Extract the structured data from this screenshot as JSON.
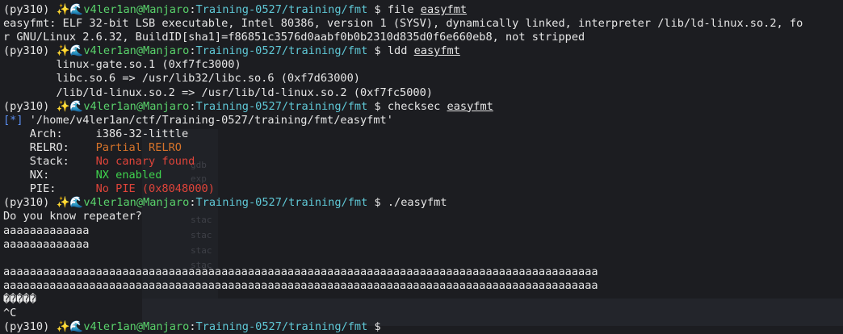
{
  "env": "(py310)",
  "user_host": "v4ler1an@Manjaro",
  "cwd_prefix": ":",
  "cwd": "Training-0527/training/fmt",
  "prompt_symbol": "$",
  "sparkle_icon": "sparkles",
  "wave_icon": "wave",
  "commands": {
    "c1": "file",
    "c1_arg": "easyfmt",
    "c2": "ldd",
    "c2_arg": "easyfmt",
    "c3": "checksec",
    "c3_arg": "easyfmt",
    "c4": "./easyfmt"
  },
  "file_output": [
    "easyfmt: ELF 32-bit LSB executable, Intel 80386, version 1 (SYSV), dynamically linked, interpreter /lib/ld-linux.so.2, fo",
    "r GNU/Linux 2.6.32, BuildID[sha1]=f86851c3576d0aabf0b0b2310d835d0f6e660eb8, not stripped"
  ],
  "ldd_output": [
    "        linux-gate.so.1 (0xf7fc3000)",
    "        libc.so.6 => /usr/lib32/libc.so.6 (0xf7d63000)",
    "        /lib/ld-linux.so.2 => /usr/lib/ld-linux.so.2 (0xf7fc5000)"
  ],
  "checksec": {
    "marker": "[*]",
    "path": " '/home/v4ler1an/ctf/Training-0527/training/fmt/easyfmt'",
    "rows": [
      {
        "key": "    Arch:     ",
        "value": "i386-32-little",
        "color": "#e6e6e6"
      },
      {
        "key": "    RELRO:    ",
        "value": "Partial RELRO",
        "color": "#d8742a"
      },
      {
        "key": "    Stack:    ",
        "value": "No canary found",
        "color": "#e0443a"
      },
      {
        "key": "    NX:       ",
        "value": "NX enabled",
        "color": "#3fd34e"
      },
      {
        "key": "    PIE:      ",
        "value": "No PIE (0x8048000)",
        "color": "#e0443a"
      }
    ]
  },
  "run_output": [
    "Do you know repeater?",
    "aaaaaaaaaaaaa",
    "aaaaaaaaaaaaa",
    "",
    "aaaaaaaaaaaaaaaaaaaaaaaaaaaaaaaaaaaaaaaaaaaaaaaaaaaaaaaaaaaaaaaaaaaaaaaaaaaaaaaaaaaaaaaaaa",
    "aaaaaaaaaaaaaaaaaaaaaaaaaaaaaaaaaaaaaaaaaaaaaaaaaaaaaaaaaaaaaaaaaaaaaaaaaaaaaaaaaaaaaaaaaa",
    "�����",
    "^C"
  ]
}
